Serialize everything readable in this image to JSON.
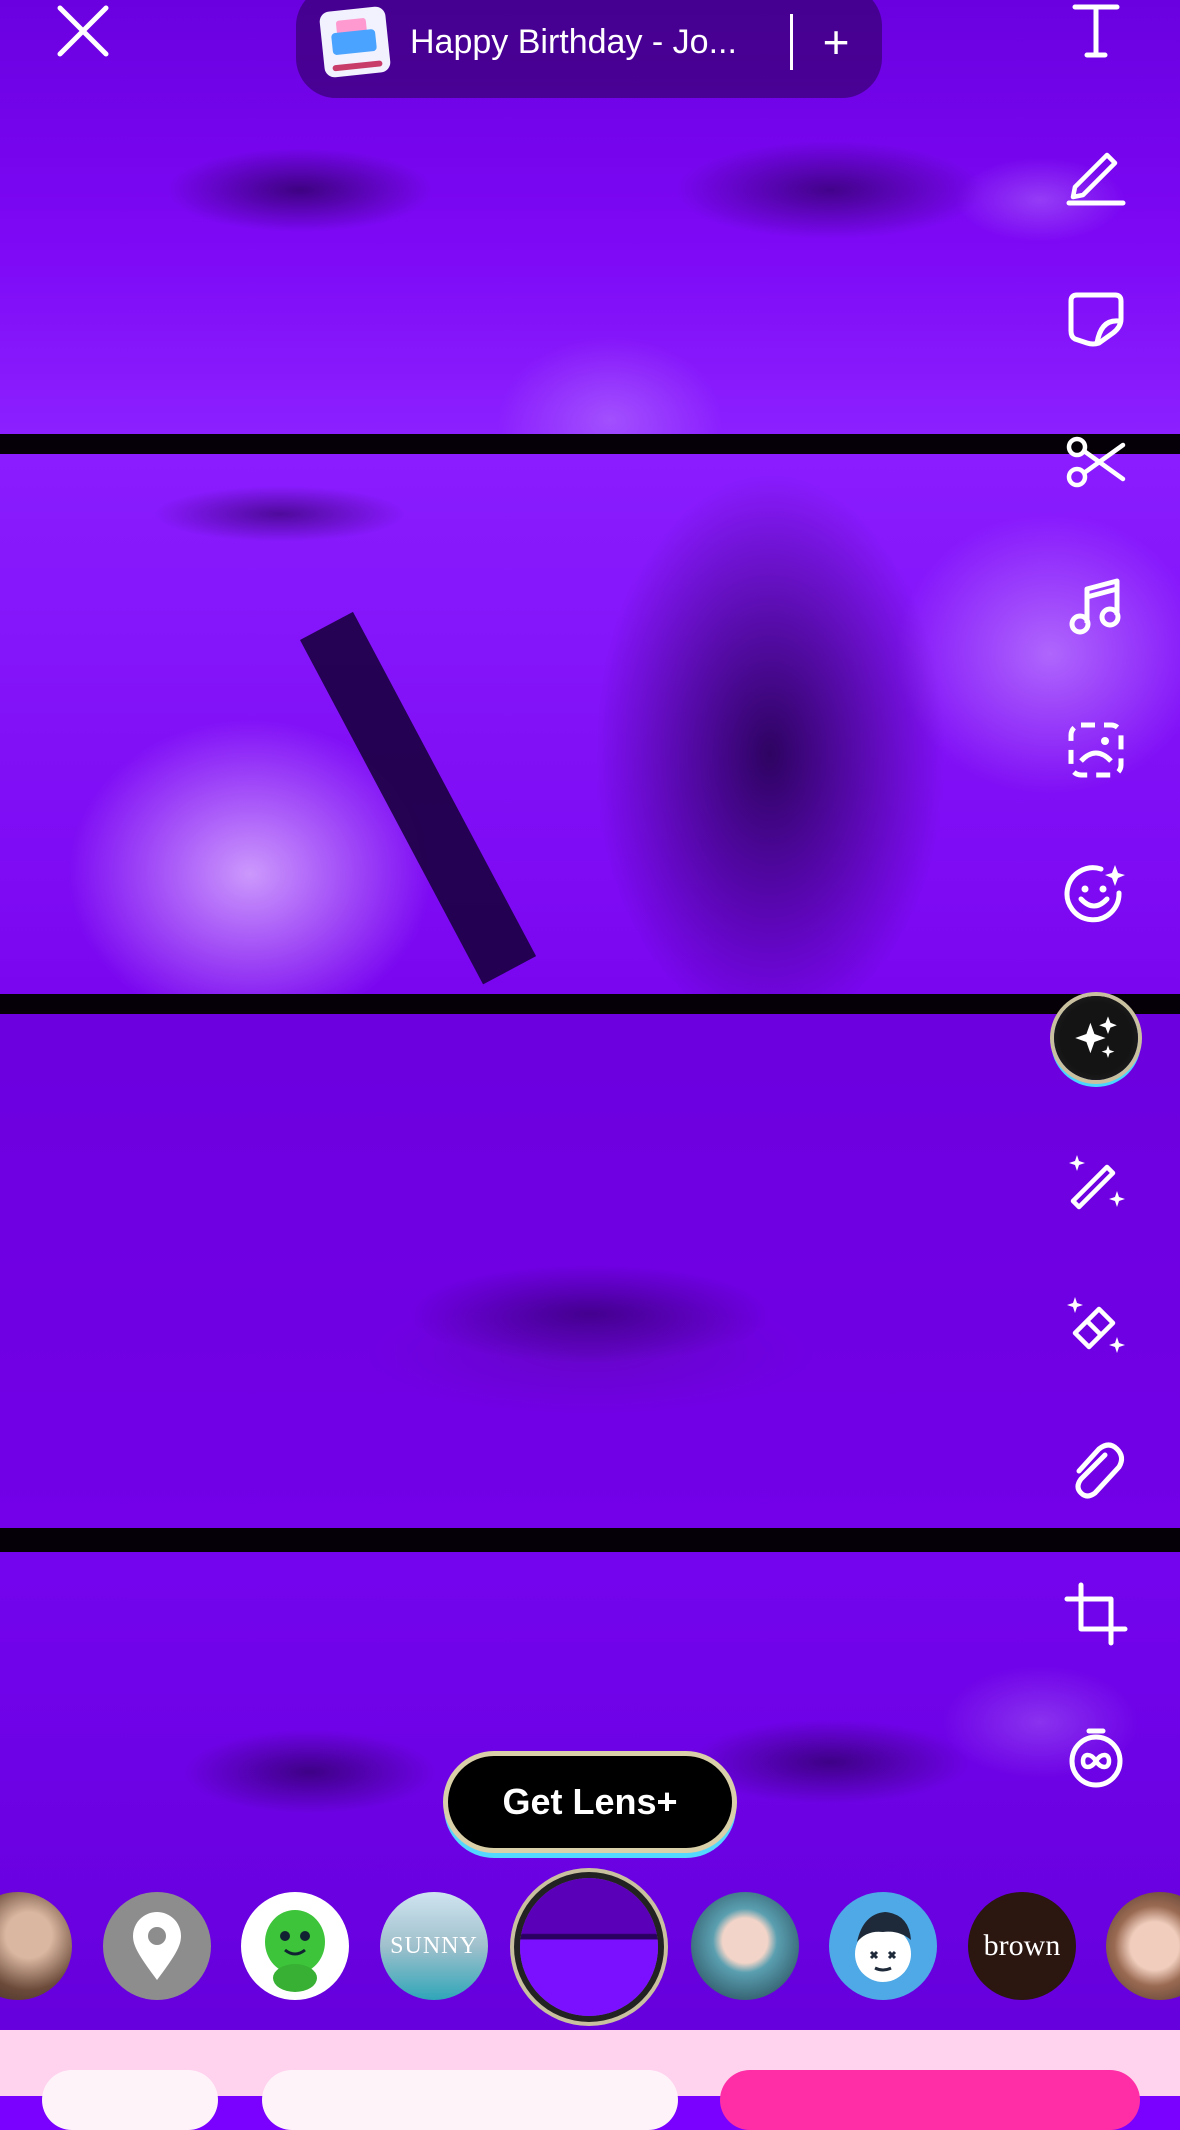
{
  "music": {
    "song_title": "Happy Birthday - Jo...",
    "add_label": "+"
  },
  "toolbar": {
    "items": [
      {
        "name": "text-icon"
      },
      {
        "name": "pencil-icon"
      },
      {
        "name": "sticker-icon"
      },
      {
        "name": "scissors-icon"
      },
      {
        "name": "music-note-icon"
      },
      {
        "name": "scan-icon"
      },
      {
        "name": "face-sparkle-icon"
      },
      {
        "name": "ai-sparkle-icon"
      },
      {
        "name": "magic-wand-icon"
      },
      {
        "name": "magic-eraser-icon"
      },
      {
        "name": "paperclip-icon"
      },
      {
        "name": "crop-icon"
      },
      {
        "name": "timer-loop-icon"
      }
    ]
  },
  "lens_button": {
    "label": "Get Lens+"
  },
  "lenses": {
    "items": [
      {
        "name": "lens-bearded-man",
        "label": ""
      },
      {
        "name": "lens-location",
        "label": ""
      },
      {
        "name": "lens-green-mascot",
        "label": ""
      },
      {
        "name": "lens-sunny",
        "label": "SUNNY"
      },
      {
        "name": "lens-selected-preview",
        "label": ""
      },
      {
        "name": "lens-woman-portrait",
        "label": ""
      },
      {
        "name": "lens-cartoon-boy",
        "label": ""
      },
      {
        "name": "lens-brown",
        "label": "brown"
      },
      {
        "name": "lens-woman-face",
        "label": ""
      }
    ]
  },
  "colors": {
    "photo_tint": "#7a00ff",
    "bottom_bar": "#ffd3ee",
    "accent_pink": "#ff2ea6"
  }
}
